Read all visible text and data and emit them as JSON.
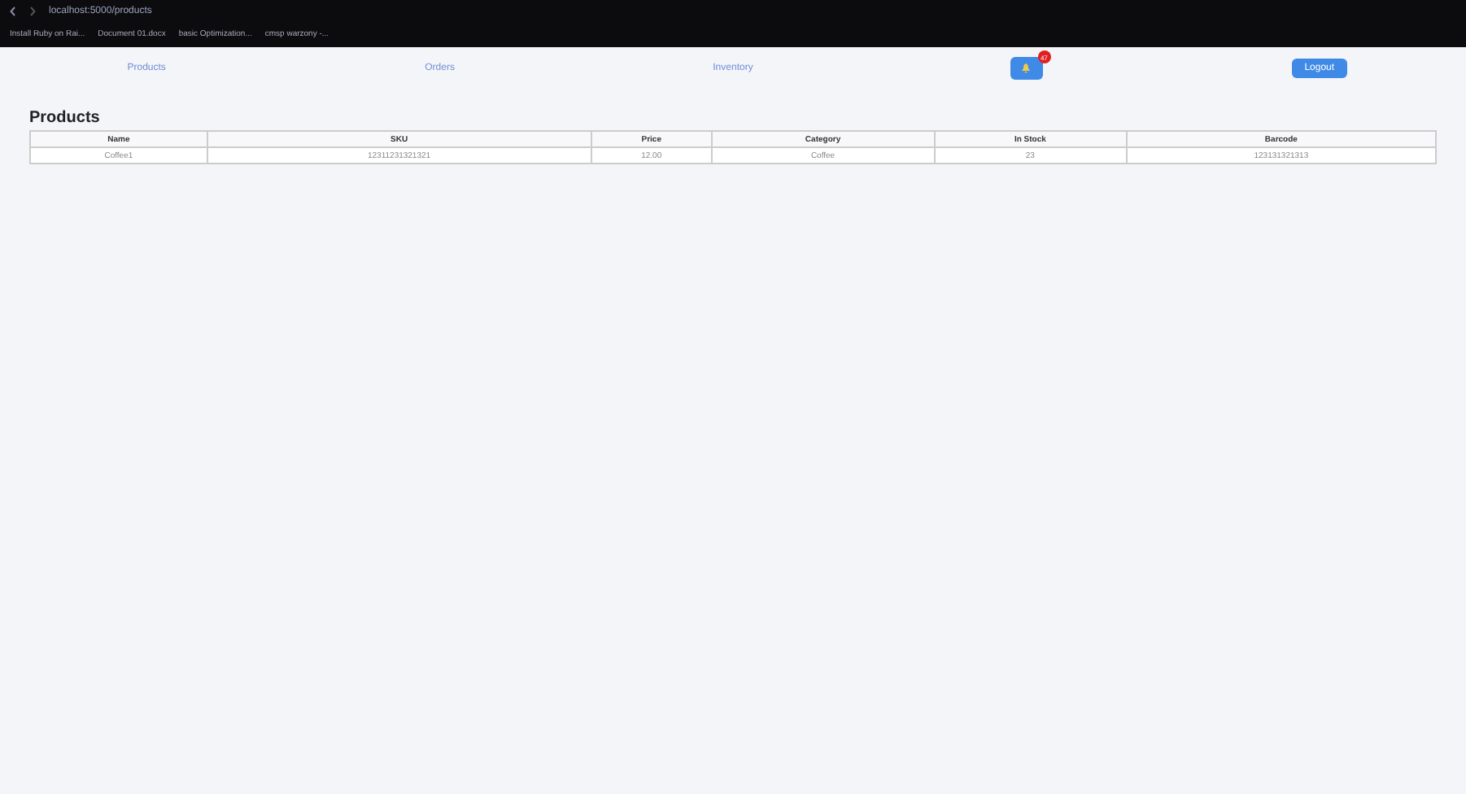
{
  "browser": {
    "url": "localhost:5000/products",
    "bookmarks": [
      "Install Ruby on Rai...",
      "Document 01.docx",
      "basic Optimization...",
      "cmsp warzony -..."
    ]
  },
  "nav": {
    "links": [
      "Products",
      "Orders",
      "Inventory"
    ],
    "notifications": "47",
    "logout": "Logout"
  },
  "title": "Products",
  "table": {
    "columns": [
      "Name",
      "SKU",
      "Price",
      "Category",
      "In Stock",
      "Barcode"
    ],
    "rows": [
      [
        "Coffee1",
        "12311231321321",
        "12.00",
        "Coffee",
        "23",
        "123131321313"
      ]
    ]
  }
}
